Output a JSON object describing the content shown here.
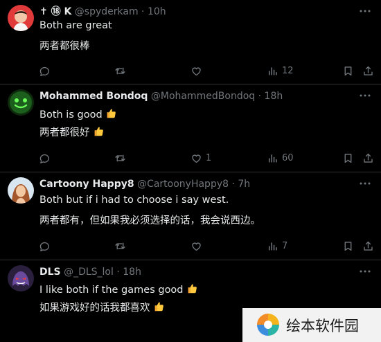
{
  "tweets": [
    {
      "name_prefix": "✝ ⑱ K",
      "handle": "@spyderkam",
      "time": "10h",
      "line1": "Both are great",
      "line2": "两者都很棒",
      "replies": "",
      "retweets": "",
      "likes": "",
      "views": "12"
    },
    {
      "name": "Mohammed Bondoq",
      "handle": "@MohammedBondoq",
      "time": "18h",
      "line1": "Both is good",
      "line2": "两者都很好",
      "replies": "",
      "retweets": "",
      "likes": "1",
      "views": "60"
    },
    {
      "name": "Cartoony Happy8",
      "handle": "@CartoonyHappy8",
      "time": "7h",
      "line1": "Both but if i had to choose i say west.",
      "line2": "两者都有，但如果我必须选择的话，我会说西边。",
      "replies": "",
      "retweets": "",
      "likes": "",
      "views": "7"
    },
    {
      "name": "DLS",
      "handle": "@_DLS_lol",
      "time": "18h",
      "line1": "I like both if the games good",
      "line2": "如果游戏好的话我都喜欢",
      "replies": "",
      "retweets": "",
      "likes": "",
      "views": ""
    }
  ],
  "separator": "·",
  "watermark": {
    "text": "绘本软件园"
  },
  "colors": {
    "background": "#000000",
    "text": "#e7e9ea",
    "muted": "#71767b",
    "divider": "#2f3336"
  },
  "icons": [
    "reply-icon",
    "retweet-icon",
    "like-icon",
    "views-icon",
    "bookmark-icon",
    "share-icon",
    "more-icon",
    "thumbs-up-emoji"
  ]
}
